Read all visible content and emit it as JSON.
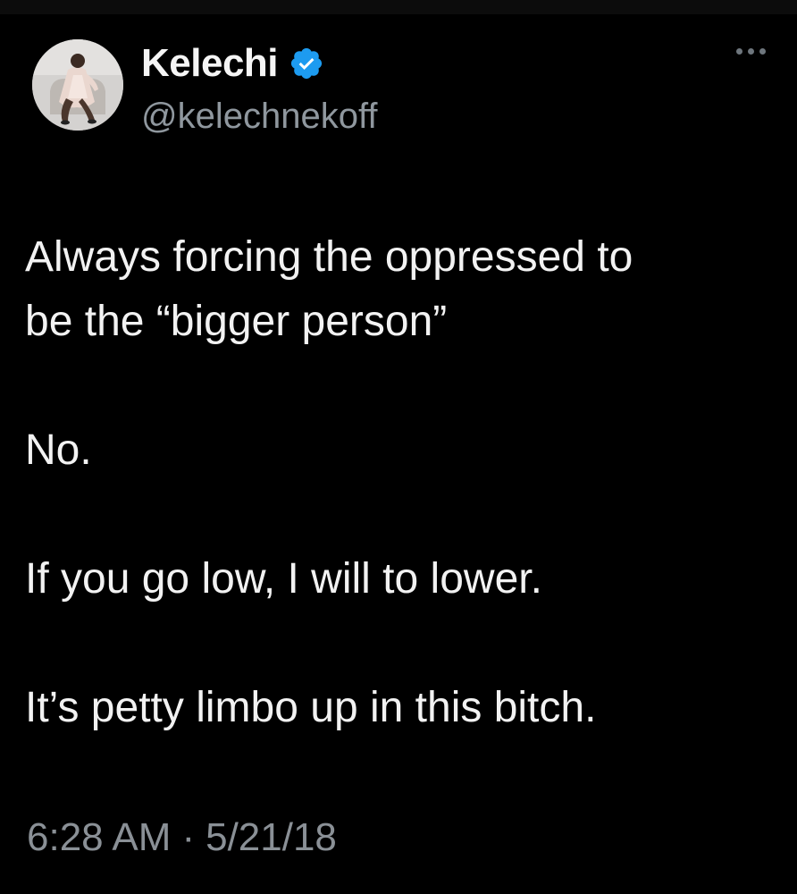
{
  "tweet": {
    "author": {
      "display_name": "Kelechi",
      "handle": "@kelechnekoff",
      "verified": true,
      "verified_color": "#1d9bf0"
    },
    "menu_icon": "more-horizontal-icon",
    "text_lines": [
      "Always forcing the oppressed to",
      "be the “bigger person”",
      "No.",
      "If you go low, I will to lower.",
      "It’s petty limbo up in this bitch."
    ],
    "time": "6:28 AM",
    "separator": "·",
    "date": "5/21/18"
  },
  "colors": {
    "background": "#000000",
    "text": "#f2f2f2",
    "secondary_text": "#8f979e"
  }
}
